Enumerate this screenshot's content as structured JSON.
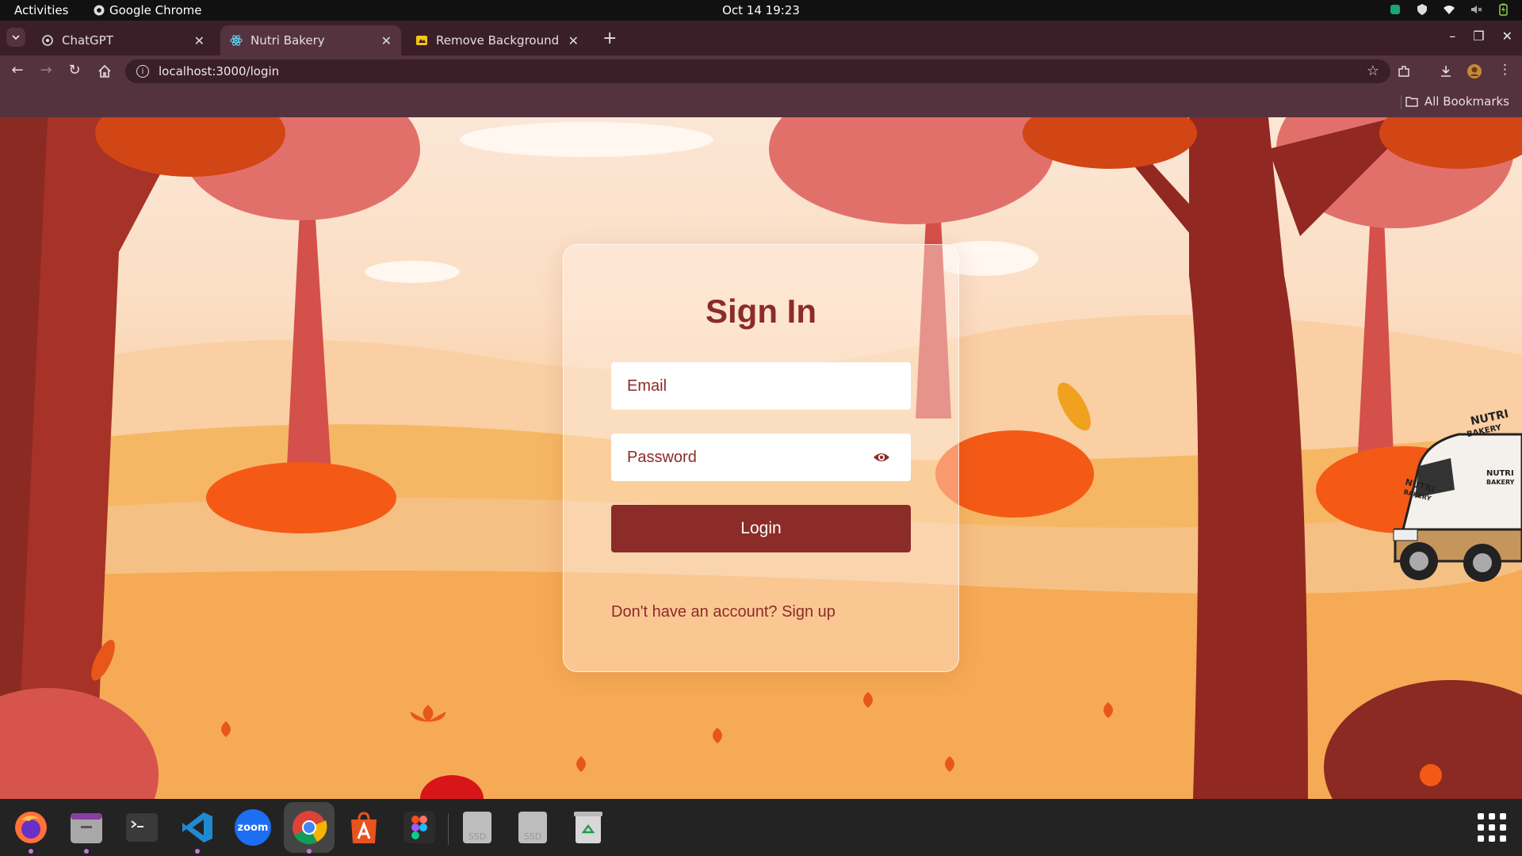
{
  "system_bar": {
    "activities": "Activities",
    "app_name": "Google Chrome",
    "clock": "Oct 14  19:23"
  },
  "browser": {
    "tabs": [
      {
        "title": "ChatGPT",
        "favicon": "openai-icon"
      },
      {
        "title": "Nutri Bakery",
        "favicon": "react-icon"
      },
      {
        "title": "Remove Background fro",
        "favicon": "remove-bg-icon"
      }
    ],
    "url": "localhost:3000/login",
    "bookmarks_label": "All Bookmarks"
  },
  "login": {
    "title": "Sign In",
    "email_placeholder": "Email",
    "password_placeholder": "Password",
    "login_label": "Login",
    "signup_prompt": "Don't have an account? ",
    "signup_link": "Sign up"
  },
  "illustration": {
    "van_brand_line1": "NUTRI",
    "van_brand_line2": "BAKERY"
  },
  "dock": {
    "apps": [
      "firefox",
      "files",
      "terminal",
      "vscode",
      "zoom",
      "chrome",
      "app-center",
      "figma",
      "ssd-drive",
      "ssd-drive",
      "trash"
    ],
    "zoom_label": "zoom",
    "ssd_label": "SSD"
  },
  "colors": {
    "brand": "#8b2c28",
    "tab_active": "#54333f",
    "tab_strip": "#3a1f29"
  }
}
